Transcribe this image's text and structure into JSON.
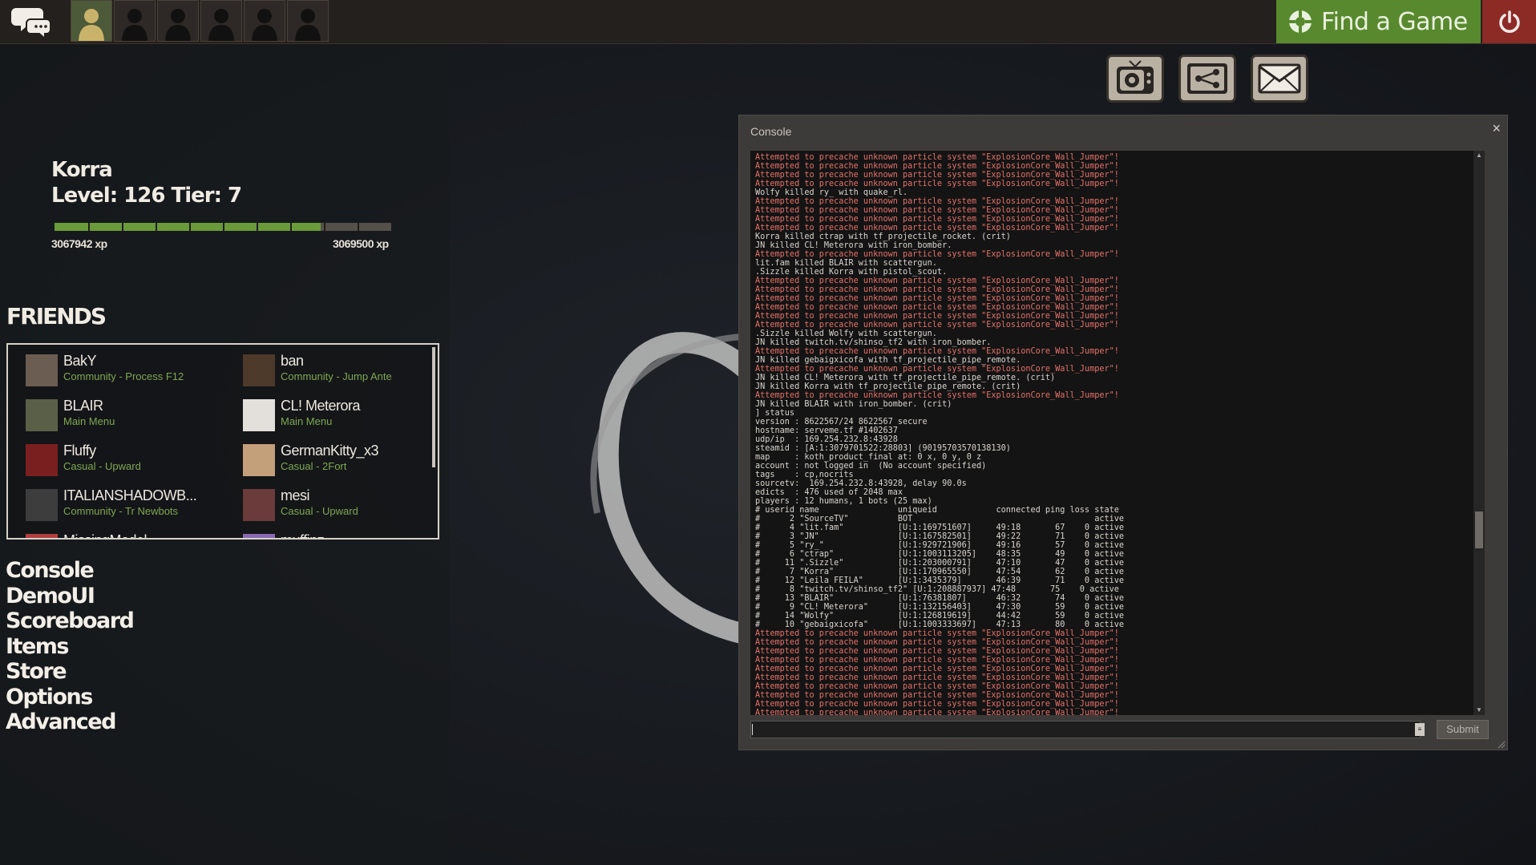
{
  "topbar": {
    "find_game_label": "Find a Game",
    "party_slots": 6
  },
  "player": {
    "name": "Korra",
    "level_text": "Level: 126 Tier: 7",
    "xp_current": "3067942 xp",
    "xp_next": "3069500 xp",
    "xp_progress": 0.79,
    "xp_segments": 10
  },
  "friends": {
    "title": "FRIENDS",
    "list": [
      {
        "name": "BakY",
        "status": "Community - Process F12"
      },
      {
        "name": "ban",
        "status": "Community - Jump Ante"
      },
      {
        "name": "BLAIR",
        "status": "Main Menu"
      },
      {
        "name": "CL! Meterora",
        "status": "Main Menu"
      },
      {
        "name": "Fluffy",
        "status": "Casual - Upward"
      },
      {
        "name": "GermanKitty_x3",
        "status": "Casual - 2Fort"
      },
      {
        "name": "ITALIANSHADOWB...",
        "status": "Community - Tr Newbots"
      },
      {
        "name": "mesi",
        "status": "Casual - Upward"
      },
      {
        "name": "MissingModel",
        "status": ""
      },
      {
        "name": "muffinz",
        "status": ""
      }
    ]
  },
  "menu": {
    "items": [
      "Console",
      "DemoUI",
      "Scoreboard",
      "Items",
      "Store",
      "Options",
      "Advanced"
    ]
  },
  "console": {
    "title": "Console",
    "close": "×",
    "submit": "Submit",
    "history_btn": "≡",
    "input_value": "",
    "lines": [
      {
        "t": "Attempted to precache unknown particle system \"ExplosionCore_Wall_Jumper\"!",
        "e": true
      },
      {
        "t": "Attempted to precache unknown particle system \"ExplosionCore_Wall_Jumper\"!",
        "e": true
      },
      {
        "t": "Attempted to precache unknown particle system \"ExplosionCore_Wall_Jumper\"!",
        "e": true
      },
      {
        "t": "Attempted to precache unknown particle system \"ExplosionCore_Wall_Jumper\"!",
        "e": true
      },
      {
        "t": "Wolfy killed ry_ with quake_rl.",
        "e": false
      },
      {
        "t": "Attempted to precache unknown particle system \"ExplosionCore_Wall_Jumper\"!",
        "e": true
      },
      {
        "t": "Attempted to precache unknown particle system \"ExplosionCore_Wall_Jumper\"!",
        "e": true
      },
      {
        "t": "Attempted to precache unknown particle system \"ExplosionCore_Wall_Jumper\"!",
        "e": true
      },
      {
        "t": "Attempted to precache unknown particle system \"ExplosionCore_Wall_Jumper\"!",
        "e": true
      },
      {
        "t": "Korra killed ctrap with tf_projectile_rocket. (crit)",
        "e": false
      },
      {
        "t": "JN killed CL! Meterora with iron_bomber.",
        "e": false
      },
      {
        "t": "Attempted to precache unknown particle system \"ExplosionCore_Wall_Jumper\"!",
        "e": true
      },
      {
        "t": "lit.fam killed BLAIR with scattergun.",
        "e": false
      },
      {
        "t": ".Sizzle killed Korra with pistol_scout.",
        "e": false
      },
      {
        "t": "Attempted to precache unknown particle system \"ExplosionCore_Wall_Jumper\"!",
        "e": true
      },
      {
        "t": "Attempted to precache unknown particle system \"ExplosionCore_Wall_Jumper\"!",
        "e": true
      },
      {
        "t": "Attempted to precache unknown particle system \"ExplosionCore_Wall_Jumper\"!",
        "e": true
      },
      {
        "t": "Attempted to precache unknown particle system \"ExplosionCore_Wall_Jumper\"!",
        "e": true
      },
      {
        "t": "Attempted to precache unknown particle system \"ExplosionCore_Wall_Jumper\"!",
        "e": true
      },
      {
        "t": "Attempted to precache unknown particle system \"ExplosionCore_Wall_Jumper\"!",
        "e": true
      },
      {
        "t": ".Sizzle killed Wolfy with scattergun.",
        "e": false
      },
      {
        "t": "JN killed twitch.tv/shinso_tf2 with iron_bomber.",
        "e": false
      },
      {
        "t": "Attempted to precache unknown particle system \"ExplosionCore_Wall_Jumper\"!",
        "e": true
      },
      {
        "t": "JN killed gebaigxicofa with tf_projectile_pipe_remote.",
        "e": false
      },
      {
        "t": "Attempted to precache unknown particle system \"ExplosionCore_Wall_Jumper\"!",
        "e": true
      },
      {
        "t": "JN killed CL! Meterora with tf_projectile_pipe_remote. (crit)",
        "e": false
      },
      {
        "t": "JN killed Korra with tf_projectile_pipe_remote. (crit)",
        "e": false
      },
      {
        "t": "Attempted to precache unknown particle system \"ExplosionCore_Wall_Jumper\"!",
        "e": true
      },
      {
        "t": "JN killed BLAIR with iron_bomber. (crit)",
        "e": false
      },
      {
        "t": "] status",
        "e": false
      },
      {
        "t": "version : 8622567/24 8622567 secure",
        "e": false
      },
      {
        "t": "hostname: serveme.tf #1402637",
        "e": false
      },
      {
        "t": "udp/ip  : 169.254.232.8:43928",
        "e": false
      },
      {
        "t": "steamid : [A:1:3079701522:28803] (90195703570138130)",
        "e": false
      },
      {
        "t": "map     : koth_product_final at: 0 x, 0 y, 0 z",
        "e": false
      },
      {
        "t": "account : not logged in  (No account specified)",
        "e": false
      },
      {
        "t": "tags    : cp,nocrits",
        "e": false
      },
      {
        "t": "sourcetv:  169.254.232.8:43928, delay 90.0s",
        "e": false
      },
      {
        "t": "edicts  : 476 used of 2048 max",
        "e": false
      },
      {
        "t": "players : 12 humans, 1 bots (25 max)",
        "e": false
      },
      {
        "t": "# userid name                uniqueid            connected ping loss state",
        "e": false
      },
      {
        "t": "#      2 \"SourceTV\"          BOT                                     active",
        "e": false
      },
      {
        "t": "#      4 \"lit.fam\"           [U:1:169751607]     49:18       67    0 active",
        "e": false
      },
      {
        "t": "#      3 \"JN\"                [U:1:167582501]     49:22       71    0 active",
        "e": false
      },
      {
        "t": "#      5 \"ry_\"               [U:1:929721906]     49:16       57    0 active",
        "e": false
      },
      {
        "t": "#      6 \"ctrap\"             [U:1:1003113205]    48:35       49    0 active",
        "e": false
      },
      {
        "t": "#     11 \".Sizzle\"           [U:1:203000791]     47:10       47    0 active",
        "e": false
      },
      {
        "t": "#      7 \"Korra\"             [U:1:170965550]     47:54       62    0 active",
        "e": false
      },
      {
        "t": "#     12 \"Leila FEILA\"       [U:1:3435379]       46:39       71    0 active",
        "e": false
      },
      {
        "t": "#      8 \"twitch.tv/shinso_tf2\" [U:1:208887937] 47:48       75    0 active",
        "e": false
      },
      {
        "t": "#     13 \"BLAIR\"             [U:1:76381807]      46:32       74    0 active",
        "e": false
      },
      {
        "t": "#      9 \"CL! Meterora\"      [U:1:132156403]     47:30       59    0 active",
        "e": false
      },
      {
        "t": "#     14 \"Wolfy\"             [U:1:126819619]     44:42       59    0 active",
        "e": false
      },
      {
        "t": "#     10 \"gebaigxicofa\"      [U:1:1003333697]    47:13       80    0 active",
        "e": false
      },
      {
        "t": "Attempted to precache unknown particle system \"ExplosionCore_Wall_Jumper\"!",
        "e": true
      },
      {
        "t": "Attempted to precache unknown particle system \"ExplosionCore_Wall_Jumper\"!",
        "e": true
      },
      {
        "t": "Attempted to precache unknown particle system \"ExplosionCore_Wall_Jumper\"!",
        "e": true
      },
      {
        "t": "Attempted to precache unknown particle system \"ExplosionCore_Wall_Jumper\"!",
        "e": true
      },
      {
        "t": "Attempted to precache unknown particle system \"ExplosionCore_Wall_Jumper\"!",
        "e": true
      },
      {
        "t": "Attempted to precache unknown particle system \"ExplosionCore_Wall_Jumper\"!",
        "e": true
      },
      {
        "t": "Attempted to precache unknown particle system \"ExplosionCore_Wall_Jumper\"!",
        "e": true
      },
      {
        "t": "Attempted to precache unknown particle system \"ExplosionCore_Wall_Jumper\"!",
        "e": true
      },
      {
        "t": "Attempted to precache unknown particle system \"ExplosionCore_Wall_Jumper\"!",
        "e": true
      },
      {
        "t": "Attempted to precache unknown particle system \"ExplosionCore_Wall_Jumper\"!",
        "e": true
      }
    ]
  },
  "colors": {
    "find_game_bg": "#59892e",
    "power_bg": "#8c2a26",
    "xp_fill": "#6a9a3a",
    "friend_status": "#7ea852",
    "console_error": "#e4716a"
  },
  "icons": [
    "chat-icon",
    "find-game-icon",
    "power-icon",
    "tv-icon",
    "workshop-icon",
    "mail-icon"
  ]
}
